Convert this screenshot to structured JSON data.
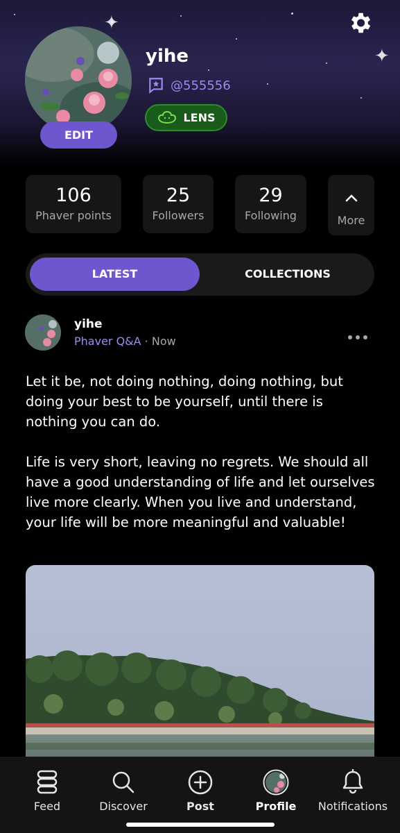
{
  "profile": {
    "name": "yihe",
    "handle": "@555556",
    "badge_label": "LENS",
    "edit_label": "EDIT"
  },
  "stats": [
    {
      "value": "106",
      "label": "Phaver points"
    },
    {
      "value": "25",
      "label": "Followers"
    },
    {
      "value": "29",
      "label": "Following"
    }
  ],
  "more_label": "More",
  "tabs": {
    "latest": "LATEST",
    "collections": "COLLECTIONS"
  },
  "post": {
    "author": "yihe",
    "community": "Phaver Q&A",
    "separator": " · ",
    "time": "Now",
    "body": "Let it be, not doing nothing, doing nothing, but doing your best to be yourself, until there is nothing you can do.\n\nLife is very short, leaving no regrets. We should all have a good understanding of life and let ourselves live more clearly. When you live and understand, your life will be more meaningful and valuable!"
  },
  "nav": [
    {
      "label": "Feed"
    },
    {
      "label": "Discover"
    },
    {
      "label": "Post"
    },
    {
      "label": "Profile"
    },
    {
      "label": "Notifications"
    }
  ],
  "colors": {
    "accent": "#6e56cf",
    "handle": "#9f8bf0",
    "lens_bg": "#1a5a1a"
  }
}
